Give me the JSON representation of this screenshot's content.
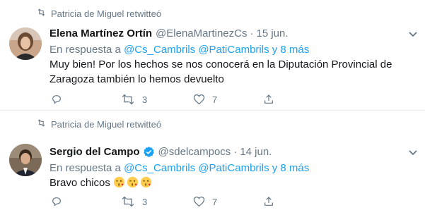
{
  "tweets": [
    {
      "retweeted_by": "Patricia de Miguel retwitteó",
      "name": "Elena Martínez Ortín",
      "handle": "@ElenaMartinezCs",
      "dot": "·",
      "date": "15 jun.",
      "reply_prefix": "En respuesta a",
      "reply_link": "@Cs_Cambrils @PatiCambrils y 8 más",
      "text": "Muy bien! Por los hechos se nos conocerá en la Diputación Provincial de Zaragoza también lo hemos devuelto",
      "retweets": "3",
      "likes": "7"
    },
    {
      "retweeted_by": "Patricia de Miguel retwitteó",
      "name": "Sergio del Campo",
      "handle": "@sdelcampocs",
      "dot": "·",
      "date": "14 jun.",
      "reply_prefix": "En respuesta a",
      "reply_link": "@Cs_Cambrils @PatiCambrils y 8 más",
      "text": "Bravo chicos",
      "emojis": [
        "face-throwing-kiss",
        "face-throwing-kiss",
        "face-throwing-kiss"
      ],
      "retweets": "3",
      "likes": "7"
    }
  ],
  "colors": {
    "accent": "#1da1f2",
    "muted": "#657786",
    "text": "#14171a",
    "divider": "#e6ecf0"
  }
}
